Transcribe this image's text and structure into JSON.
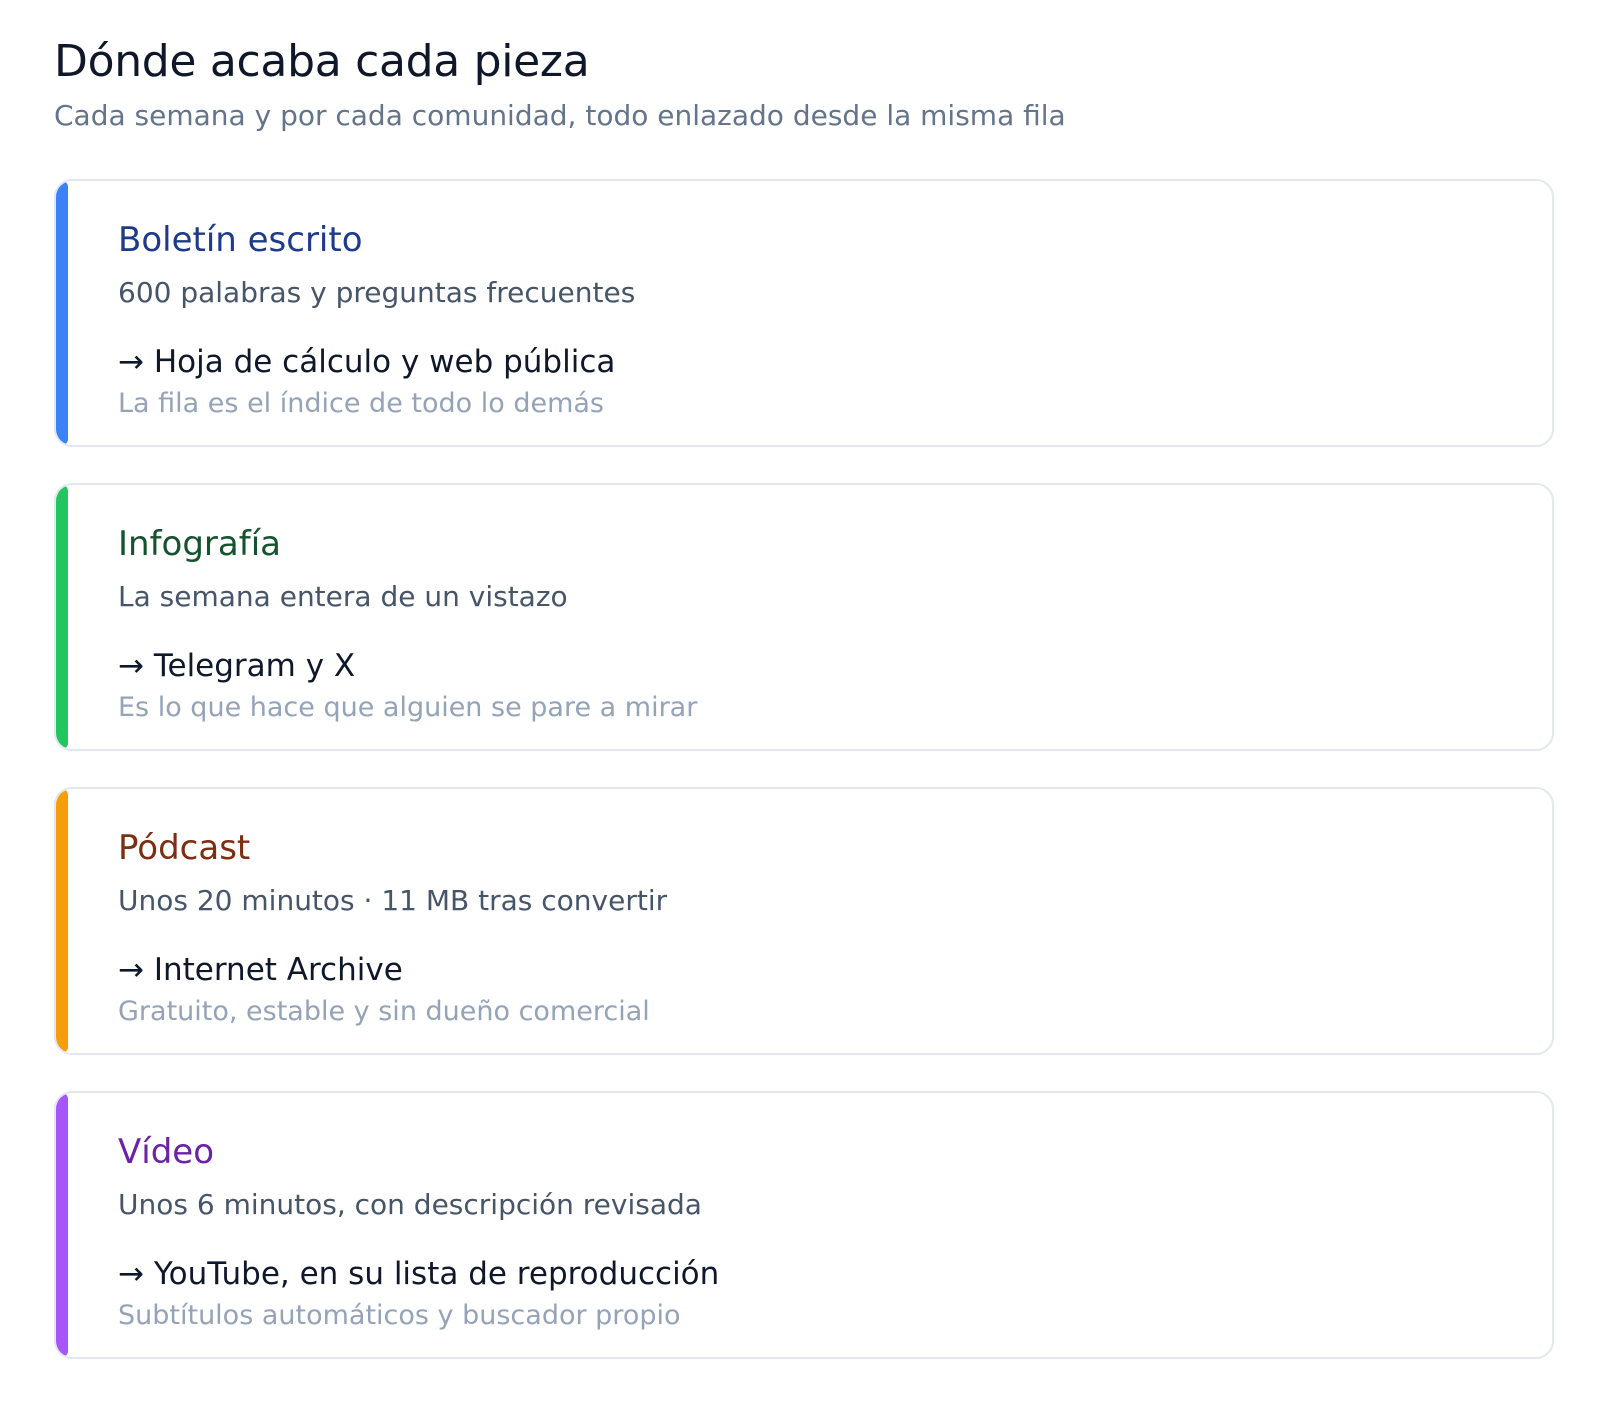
{
  "header": {
    "title": "Dónde acaba cada pieza",
    "subtitle": "Cada semana y por cada comunidad, todo enlazado desde la misma fila"
  },
  "cards": [
    {
      "title": "Boletín escrito",
      "description": "600 palabras y preguntas frecuentes",
      "destination": "→ Hoja de cálculo y web pública",
      "note": "La fila es el índice de todo lo demás",
      "accent_color": "#3b82f6",
      "title_color": "#1e3a8a"
    },
    {
      "title": "Infografía",
      "description": "La semana entera de un vistazo",
      "destination": "→ Telegram y X",
      "note": "Es lo que hace que alguien se pare a mirar",
      "accent_color": "#22c55e",
      "title_color": "#14532d"
    },
    {
      "title": "Pódcast",
      "description": "Unos 20 minutos · 11 MB tras convertir",
      "destination": "→ Internet Archive",
      "note": "Gratuito, estable y sin dueño comercial",
      "accent_color": "#f59e0b",
      "title_color": "#7c2d12"
    },
    {
      "title": "Vídeo",
      "description": "Unos 6 minutos, con descripción revisada",
      "destination": "→ YouTube, en su lista de reproducción",
      "note": "Subtítulos automáticos y buscador propio",
      "accent_color": "#a855f7",
      "title_color": "#6b21a8"
    }
  ]
}
